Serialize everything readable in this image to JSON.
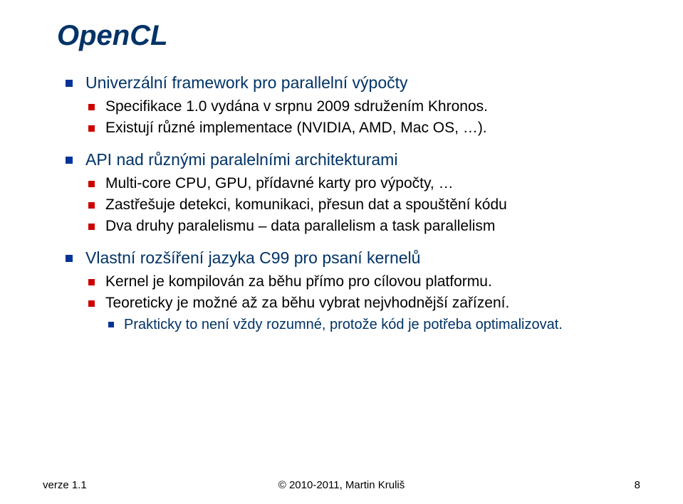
{
  "title": "OpenCL",
  "bullets": [
    {
      "text": "Univerzální framework pro parallelní výpočty",
      "children": [
        {
          "text": "Specifikace 1.0 vydána v srpnu 2009 sdružením Khronos."
        },
        {
          "text": "Existují různé implementace (NVIDIA, AMD, Mac OS, …)."
        }
      ]
    },
    {
      "text": "API nad různými paralelními architekturami",
      "children": [
        {
          "text": "Multi-core CPU, GPU, přídavné karty pro výpočty, …"
        },
        {
          "text": "Zastřešuje detekci, komunikaci, přesun dat a spouštění kódu"
        },
        {
          "text": "Dva druhy paralelismu – data parallelism a task parallelism"
        }
      ]
    },
    {
      "text": "Vlastní rozšíření jazyka C99 pro psaní kernelů",
      "children": [
        {
          "text": "Kernel je kompilován za běhu přímo pro cílovou platformu."
        },
        {
          "text": "Teoreticky je možné až za běhu vybrat nejvhodnější zařízení.",
          "children": [
            {
              "text": "Prakticky to není vždy rozumné, protože kód je potřeba optimalizovat."
            }
          ]
        }
      ]
    }
  ],
  "footer": {
    "left": "verze 1.1",
    "center": "© 2010-2011, Martin Kruliš",
    "right": "8"
  }
}
